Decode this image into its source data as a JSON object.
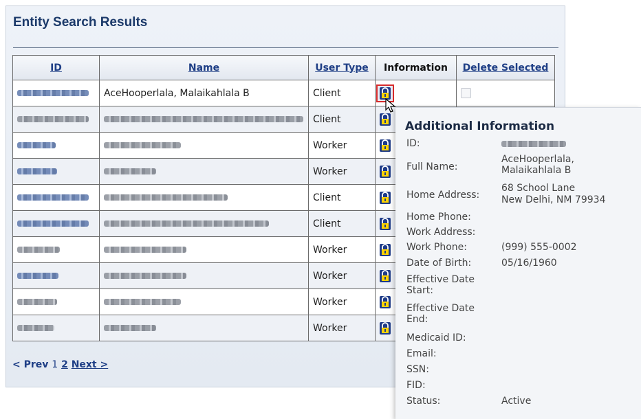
{
  "page": {
    "title": "Entity Search Results"
  },
  "table": {
    "columns": [
      "ID",
      "Name",
      "User Type",
      "Information",
      "Delete Selected"
    ],
    "rows": [
      {
        "name": "AceHooperlala, Malaikahlala B",
        "user_type": "Client",
        "id_blurred": true
      },
      {
        "name": "",
        "user_type": "Client"
      },
      {
        "name": "",
        "user_type": "Worker"
      },
      {
        "name": "",
        "user_type": "Worker"
      },
      {
        "name": "",
        "user_type": "Client"
      },
      {
        "name": "",
        "user_type": "Client"
      },
      {
        "name": "",
        "user_type": "Worker"
      },
      {
        "name": "",
        "user_type": "Worker"
      },
      {
        "name": "",
        "user_type": "Worker"
      },
      {
        "name": "",
        "user_type": "Worker"
      }
    ]
  },
  "pager": {
    "prev": "< Prev",
    "current": "1",
    "page2": "2",
    "next": "Next >"
  },
  "tooltip": {
    "title": "Additional Information",
    "fields": [
      {
        "label": "ID:",
        "value": ""
      },
      {
        "label": "Full Name:",
        "value": "AceHooperlala,",
        "value2": "Malaikahlala B"
      },
      {
        "label": "Home Address:",
        "value": "68 School Lane",
        "value2": "New Delhi, NM 79934"
      },
      {
        "label": "Home Phone:",
        "value": ""
      },
      {
        "label": "Work Address:",
        "value": ""
      },
      {
        "label": "Work Phone:",
        "value": "(999) 555-0002"
      },
      {
        "label": "Date of Birth:",
        "value": "05/16/1960"
      },
      {
        "label": "Effective Date",
        "label2": "Start:",
        "value": ""
      },
      {
        "label": "Effective Date",
        "label2": "End:",
        "value": ""
      },
      {
        "label": "Medicaid ID:",
        "value": ""
      },
      {
        "label": "Email:",
        "value": ""
      },
      {
        "label": "SSN:",
        "value": ""
      },
      {
        "label": "FID:",
        "value": ""
      },
      {
        "label": "Status:",
        "value": "Active"
      }
    ]
  },
  "icons": {
    "info": "lock-icon",
    "cursor": "pointer-cursor-icon"
  }
}
